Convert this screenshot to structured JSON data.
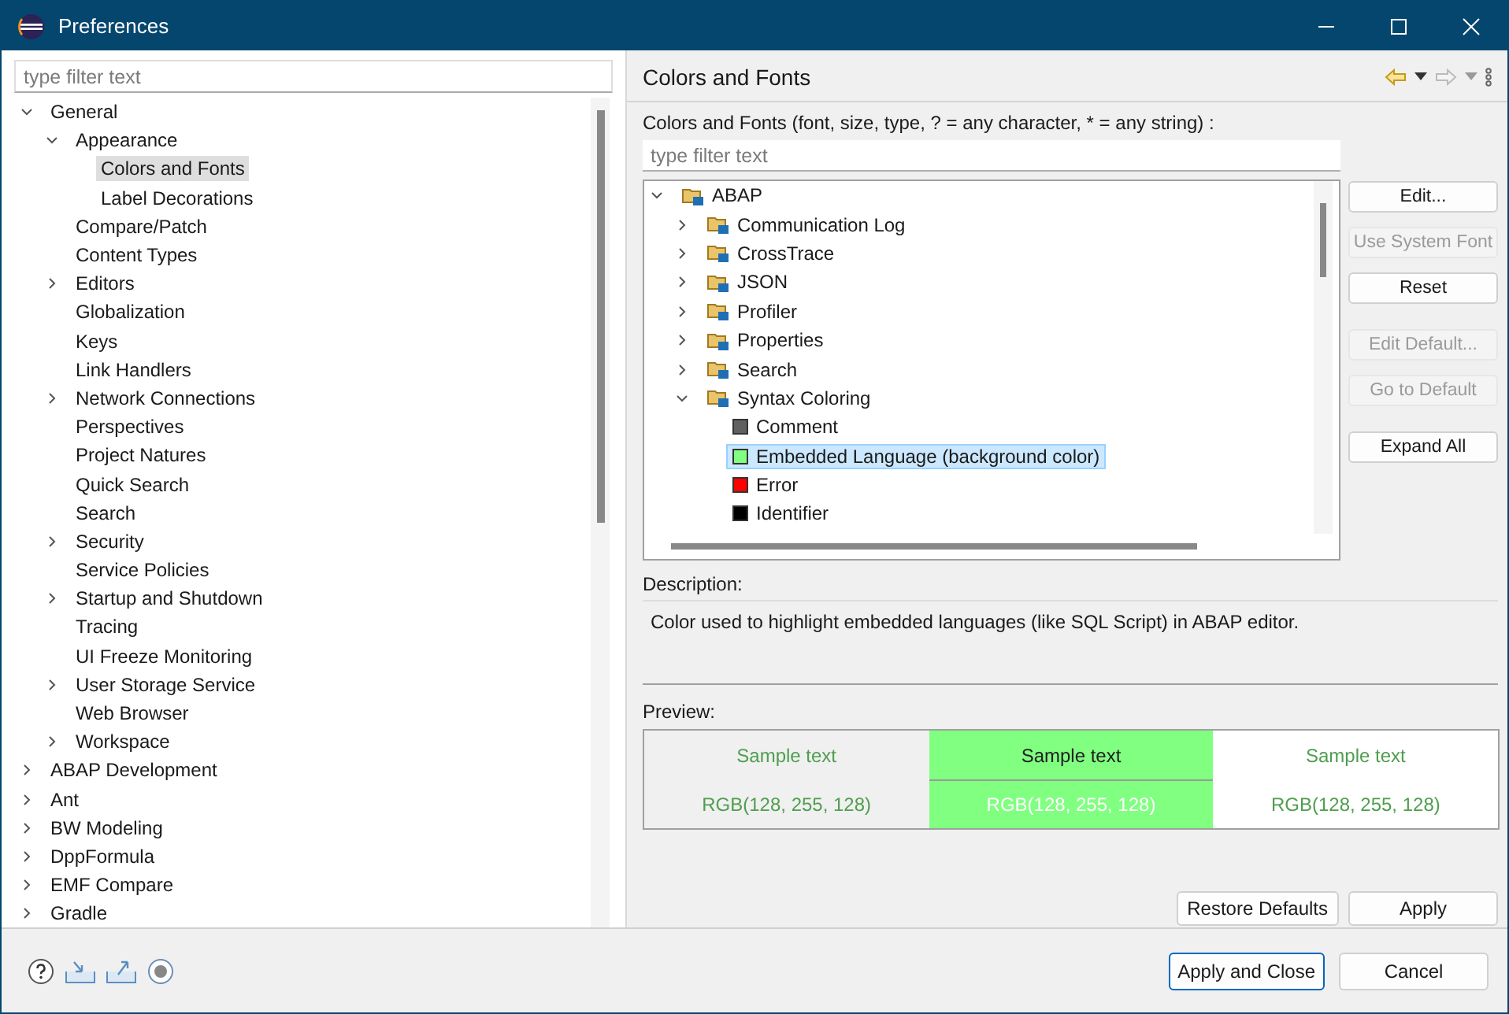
{
  "window": {
    "title": "Preferences"
  },
  "nav_filter": {
    "placeholder": "type filter text"
  },
  "nav_tree": [
    {
      "label": "General",
      "expanded": true,
      "selected": false,
      "children": [
        {
          "label": "Appearance",
          "expanded": true,
          "selected": false,
          "children": [
            {
              "label": "Colors and Fonts",
              "selected": true
            },
            {
              "label": "Label Decorations",
              "selected": false
            }
          ]
        },
        {
          "label": "Compare/Patch",
          "selected": false
        },
        {
          "label": "Content Types",
          "selected": false
        },
        {
          "label": "Editors",
          "expanded": false,
          "selected": false
        },
        {
          "label": "Globalization",
          "selected": false
        },
        {
          "label": "Keys",
          "selected": false
        },
        {
          "label": "Link Handlers",
          "selected": false
        },
        {
          "label": "Network Connections",
          "expanded": false,
          "selected": false
        },
        {
          "label": "Perspectives",
          "selected": false
        },
        {
          "label": "Project Natures",
          "selected": false
        },
        {
          "label": "Quick Search",
          "selected": false
        },
        {
          "label": "Search",
          "selected": false
        },
        {
          "label": "Security",
          "expanded": false,
          "selected": false
        },
        {
          "label": "Service Policies",
          "selected": false
        },
        {
          "label": "Startup and Shutdown",
          "expanded": false,
          "selected": false
        },
        {
          "label": "Tracing",
          "selected": false
        },
        {
          "label": "UI Freeze Monitoring",
          "selected": false
        },
        {
          "label": "User Storage Service",
          "expanded": false,
          "selected": false
        },
        {
          "label": "Web Browser",
          "selected": false
        },
        {
          "label": "Workspace",
          "expanded": false,
          "selected": false
        }
      ]
    },
    {
      "label": "ABAP Development",
      "expanded": false,
      "selected": false
    },
    {
      "label": "Ant",
      "expanded": false,
      "selected": false
    },
    {
      "label": "BW Modeling",
      "expanded": false,
      "selected": false
    },
    {
      "label": "DppFormula",
      "expanded": false,
      "selected": false
    },
    {
      "label": "EMF Compare",
      "expanded": false,
      "selected": false
    },
    {
      "label": "Gradle",
      "expanded": false,
      "selected": false
    }
  ],
  "page": {
    "title": "Colors and Fonts",
    "intro": "Colors and Fonts (font, size, type, ? = any character, * = any string) :"
  },
  "color_filter": {
    "placeholder": "type filter text"
  },
  "color_tree": [
    {
      "label": "ABAP",
      "kind": "category",
      "expanded": true,
      "selected": false,
      "children": [
        {
          "label": "Communication Log",
          "kind": "category",
          "expanded": false,
          "selected": false
        },
        {
          "label": "CrossTrace",
          "kind": "category",
          "expanded": false,
          "selected": false
        },
        {
          "label": "JSON",
          "kind": "category",
          "expanded": false,
          "selected": false
        },
        {
          "label": "Profiler",
          "kind": "category",
          "expanded": false,
          "selected": false
        },
        {
          "label": "Properties",
          "kind": "category",
          "expanded": false,
          "selected": false
        },
        {
          "label": "Search",
          "kind": "category",
          "expanded": false,
          "selected": false
        },
        {
          "label": "Syntax Coloring",
          "kind": "category",
          "expanded": true,
          "selected": false,
          "children": [
            {
              "label": "Comment",
              "kind": "color",
              "color": "#606060",
              "selected": false
            },
            {
              "label": "Embedded Language (background color)",
              "kind": "color",
              "color": "#80ff80",
              "selected": true
            },
            {
              "label": "Error",
              "kind": "color",
              "color": "#ff0000",
              "selected": false
            },
            {
              "label": "Identifier",
              "kind": "color",
              "color": "#000000",
              "selected": false
            }
          ]
        }
      ]
    }
  ],
  "side_button_groups": [
    {
      "buttons": [
        {
          "label": "Edit...",
          "disabled": false
        },
        {
          "label": "Use System Font",
          "disabled": true
        },
        {
          "label": "Reset",
          "disabled": false
        }
      ]
    },
    {
      "buttons": [
        {
          "label": "Edit Default...",
          "disabled": true
        },
        {
          "label": "Go to Default",
          "disabled": true
        }
      ]
    },
    {
      "buttons": [
        {
          "label": "Expand All",
          "disabled": false
        }
      ]
    }
  ],
  "description": {
    "label": "Description:",
    "text": "Color used to highlight embedded languages (like SQL Script) in ABAP editor."
  },
  "preview": {
    "label": "Preview:",
    "color": "#80ff80",
    "cells": [
      {
        "kind": "foreground",
        "sample": "Sample text",
        "rgb": "RGB(128, 255, 128)"
      },
      {
        "kind": "background",
        "sample": "Sample text",
        "rgb": "RGB(128, 255, 128)"
      },
      {
        "kind": "foreground-on-white",
        "sample": "Sample text",
        "rgb": "RGB(128, 255, 128)"
      }
    ]
  },
  "page_buttons": [
    "Restore Defaults",
    "Apply"
  ],
  "dialog_buttons": [
    {
      "label": "Apply and Close",
      "default": true
    },
    {
      "label": "Cancel",
      "default": false
    }
  ]
}
